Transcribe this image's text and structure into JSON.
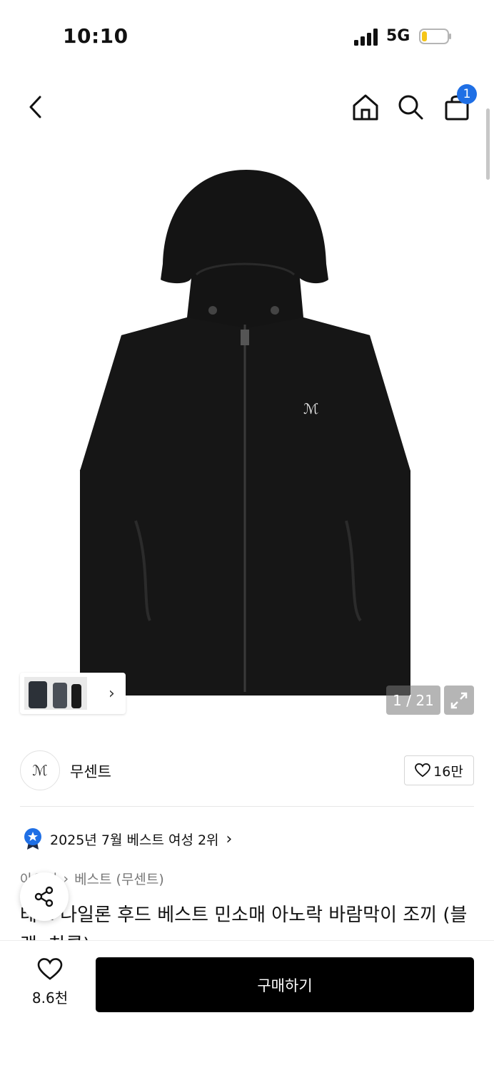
{
  "status_bar": {
    "time": "10:10",
    "network": "5G"
  },
  "header": {
    "cart_count": "1"
  },
  "gallery": {
    "counter": "1 / 21"
  },
  "brand": {
    "logo_text": "ℳ",
    "name": "무센트",
    "like_count": "16만"
  },
  "ranking": {
    "text": "2025년 7월 베스트 여성 2위"
  },
  "breadcrumb": {
    "first": "아우터",
    "second": "베스트 (무센트)"
  },
  "product": {
    "title": "테크 나일론 후드 베스트 민소매 아노락 바람막이 조끼 (블랙, 차콜)"
  },
  "bottom": {
    "wish_count": "8.6천",
    "buy_label": "구매하기"
  },
  "colors": {
    "accent": "#1f6fe5",
    "buy_button": "#000000"
  }
}
